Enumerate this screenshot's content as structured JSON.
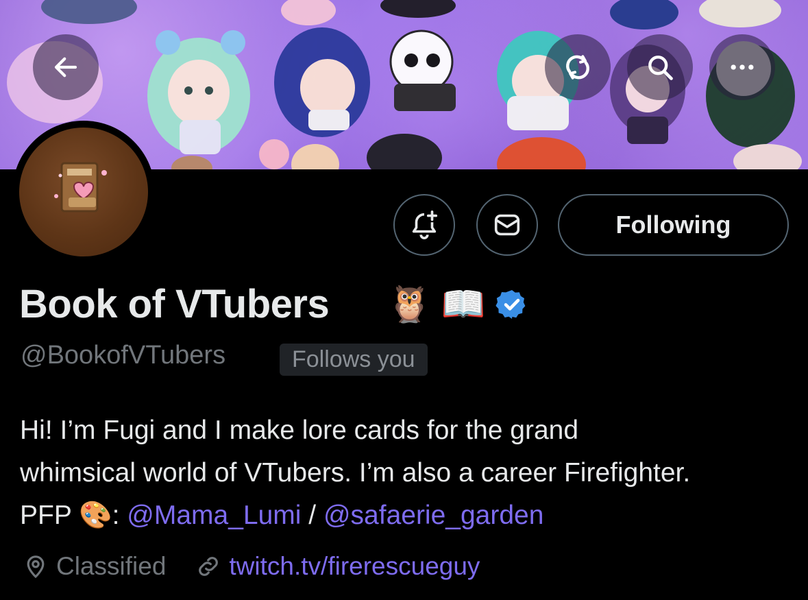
{
  "header": {
    "back_icon": "arrow-left-icon",
    "refresh_icon": "refresh-icon",
    "search_icon": "search-icon",
    "more_icon": "more-horizontal-icon"
  },
  "actions": {
    "notify_icon": "bell-plus-icon",
    "message_icon": "mail-icon",
    "following_label": "Following"
  },
  "profile": {
    "display_name": "Book of VTubers",
    "name_emojis": [
      "🦉",
      "📖"
    ],
    "verified_icon": "verified-badge-icon",
    "handle": "@BookofVTubers",
    "follows_you": "Follows you",
    "bio": {
      "line1": "Hi! I’m Fugi and I make lore cards for the grand",
      "line2": "whimsical world of VTubers. I’m also a career Firefighter.",
      "line3_prefix": "PFP",
      "line3_emoji": "🎨",
      "line3_colon": ":",
      "mention1": "@Mama_Lumi",
      "separator": "/",
      "mention2": "@safaerie_garden"
    },
    "location_icon": "location-pin-icon",
    "location": "Classified",
    "link_icon": "link-icon",
    "website": "twitch.tv/firerescueguy"
  },
  "colors": {
    "background": "#000000",
    "accent_link": "#7e6cf0",
    "verified": "#3a8fe6",
    "muted": "#71767b"
  }
}
